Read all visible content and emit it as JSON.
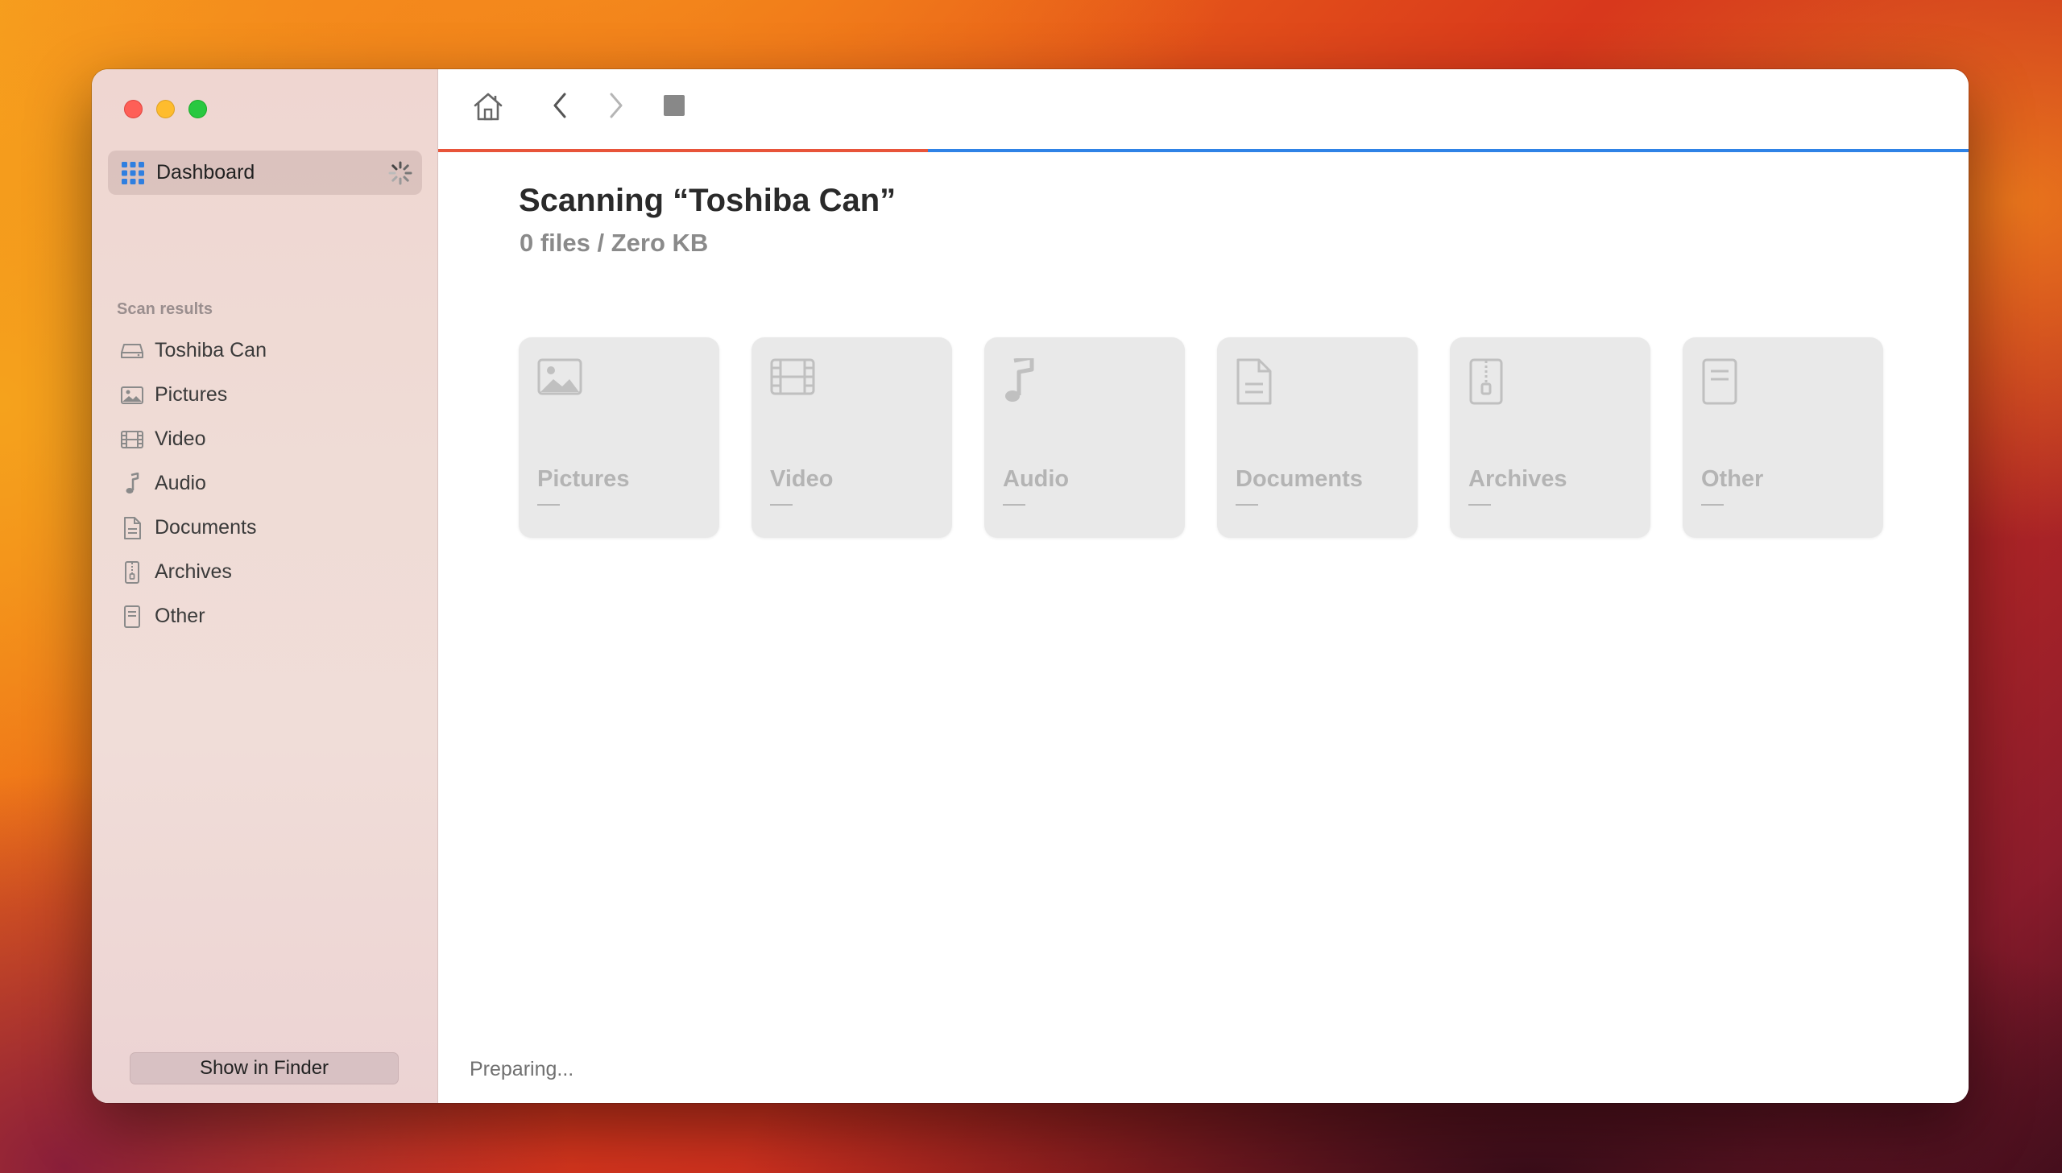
{
  "sidebar": {
    "dashboard_label": "Dashboard",
    "section_label": "Scan results",
    "items": [
      {
        "label": "Toshiba Can",
        "icon": "drive-icon"
      },
      {
        "label": "Pictures",
        "icon": "photo-icon"
      },
      {
        "label": "Video",
        "icon": "film-icon"
      },
      {
        "label": "Audio",
        "icon": "music-note-icon"
      },
      {
        "label": "Documents",
        "icon": "document-icon"
      },
      {
        "label": "Archives",
        "icon": "archive-icon"
      },
      {
        "label": "Other",
        "icon": "other-doc-icon"
      }
    ],
    "show_in_finder_label": "Show in Finder"
  },
  "toolbar": {
    "home_icon": "home-icon",
    "back_icon": "chevron-left-icon",
    "forward_icon": "chevron-right-icon",
    "stop_icon": "stop-icon"
  },
  "scan": {
    "progress_fraction": 0.32,
    "progress_color": "#e8543a",
    "track_color": "#2f83e6",
    "title": "Scanning “Toshiba Can”",
    "subtitle": "0 files / Zero KB"
  },
  "cards": [
    {
      "name": "Pictures",
      "value": "—",
      "icon": "photo-icon"
    },
    {
      "name": "Video",
      "value": "—",
      "icon": "film-icon"
    },
    {
      "name": "Audio",
      "value": "—",
      "icon": "music-note-icon"
    },
    {
      "name": "Documents",
      "value": "—",
      "icon": "document-icon"
    },
    {
      "name": "Archives",
      "value": "—",
      "icon": "archive-icon"
    },
    {
      "name": "Other",
      "value": "—",
      "icon": "other-doc-icon"
    }
  ],
  "status_text": "Preparing..."
}
